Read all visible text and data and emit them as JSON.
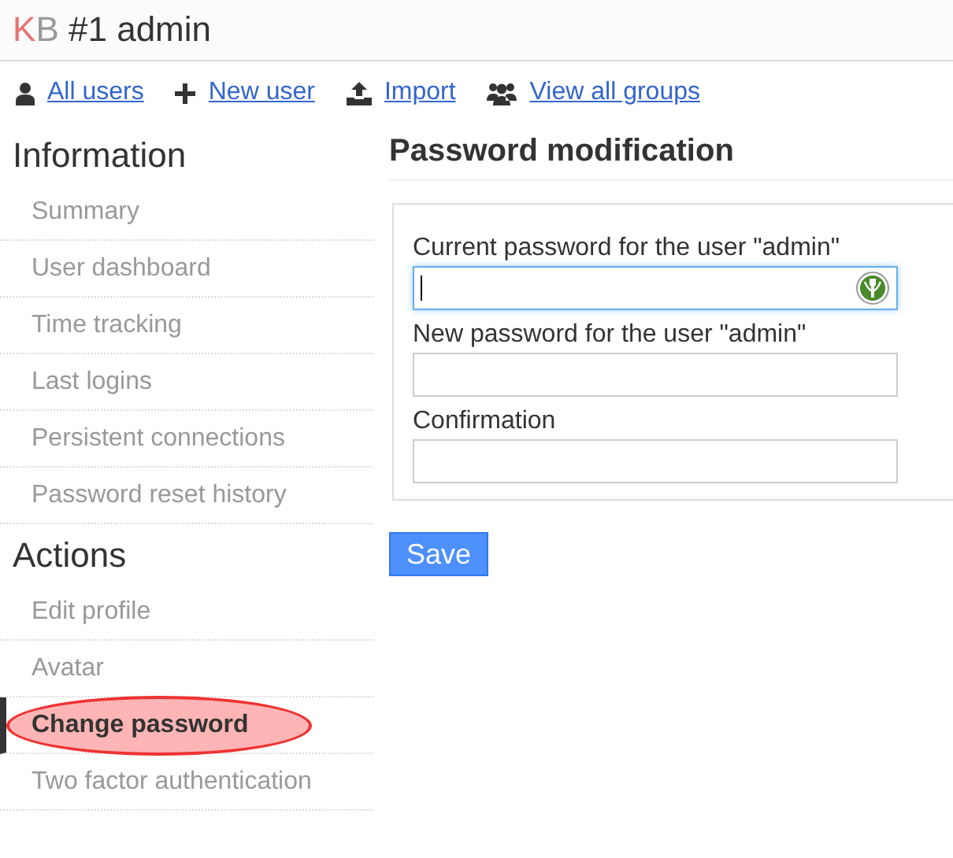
{
  "header": {
    "logo": [
      "K",
      "B"
    ],
    "title": "#1 admin"
  },
  "nav_links": [
    {
      "kind": "user",
      "label": "All users"
    },
    {
      "kind": "plus",
      "label": "New user"
    },
    {
      "kind": "upload",
      "label": "Import"
    },
    {
      "kind": "group",
      "label": "View all groups"
    }
  ],
  "sidebar": [
    {
      "heading": "Information",
      "items": [
        {
          "label": "Summary",
          "selected": false,
          "highlighted": false
        },
        {
          "label": "User dashboard",
          "selected": false,
          "highlighted": false
        },
        {
          "label": "Time tracking",
          "selected": false,
          "highlighted": false
        },
        {
          "label": "Last logins",
          "selected": false,
          "highlighted": false
        },
        {
          "label": "Persistent connections",
          "selected": false,
          "highlighted": false
        },
        {
          "label": "Password reset history",
          "selected": false,
          "highlighted": false
        }
      ]
    },
    {
      "heading": "Actions",
      "items": [
        {
          "label": "Edit profile",
          "selected": false,
          "highlighted": false
        },
        {
          "label": "Avatar",
          "selected": false,
          "highlighted": false
        },
        {
          "label": "Change password",
          "selected": true,
          "highlighted": true
        },
        {
          "label": "Two factor authentication",
          "selected": false,
          "highlighted": false
        }
      ]
    }
  ],
  "main": {
    "title": "Password modification",
    "fields": [
      {
        "label": "Current password for the user \"admin\"",
        "focused": true,
        "password_manager_icon": true
      },
      {
        "label": "New password for the user \"admin\"",
        "focused": false,
        "password_manager_icon": false
      },
      {
        "label": "Confirmation",
        "focused": false,
        "password_manager_icon": false
      }
    ],
    "save_button": "Save"
  }
}
